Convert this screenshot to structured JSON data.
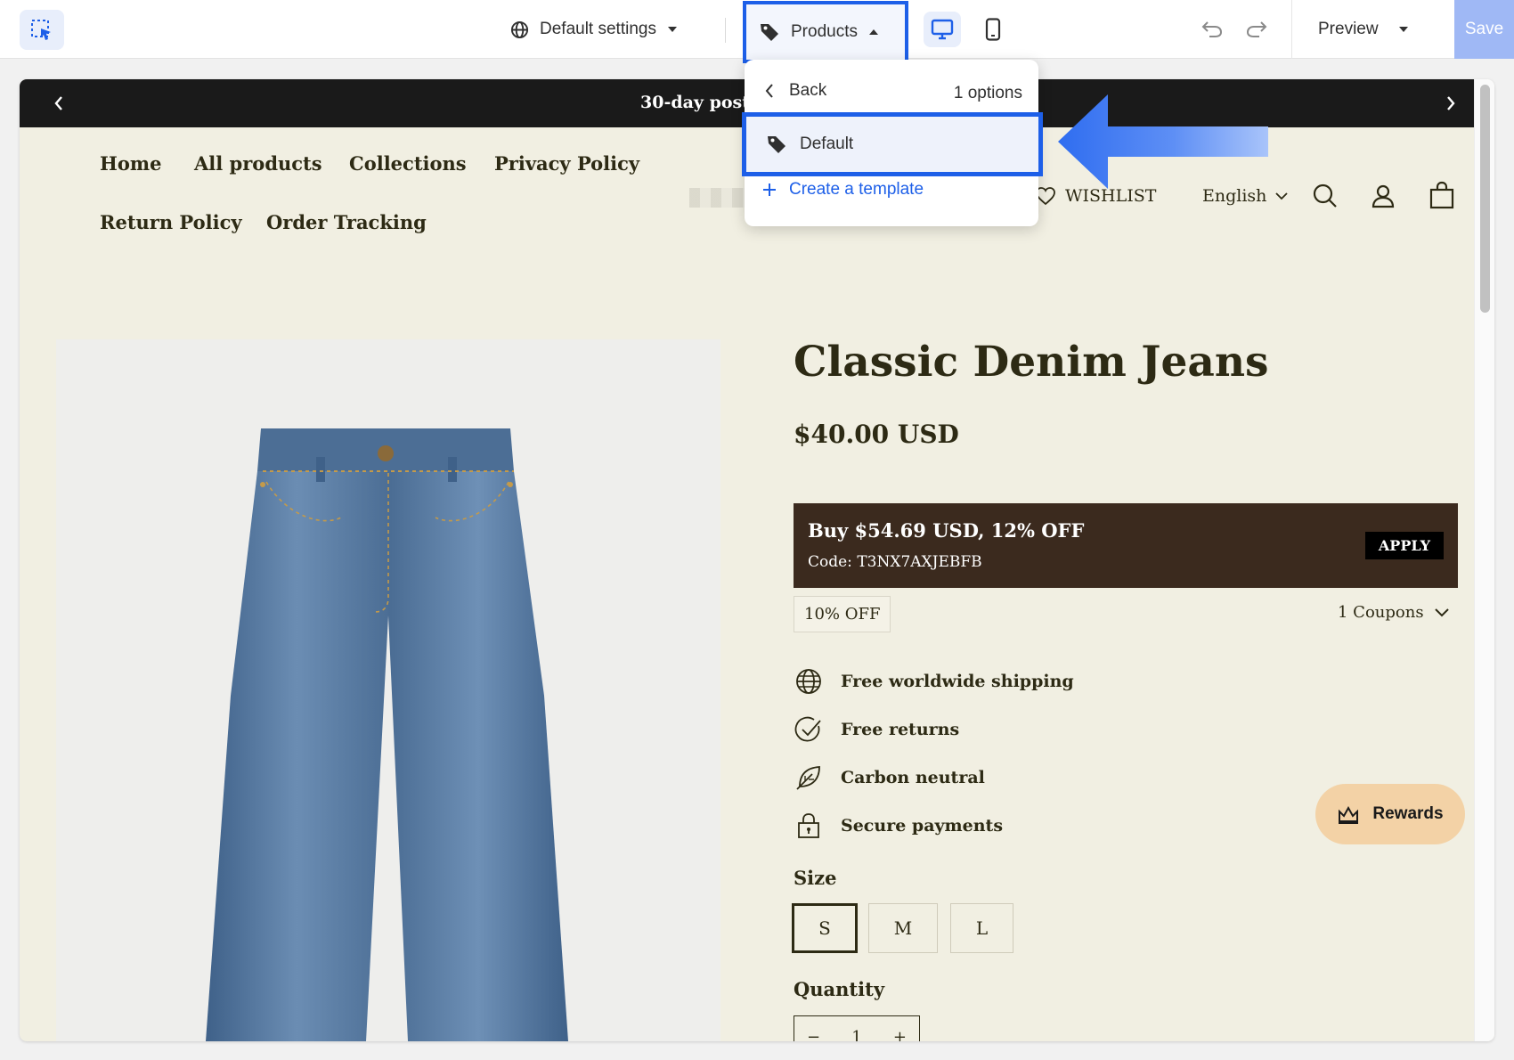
{
  "toolbar": {
    "settings_label": "Default settings",
    "template_label": "Products",
    "preview_label": "Preview",
    "save_label": "Save",
    "accent_color": "#1d5fe8"
  },
  "dropdown": {
    "back_label": "Back",
    "options_count": "1 options",
    "selected_option": "Default",
    "create_label": "Create a template"
  },
  "store": {
    "announcement": "30-day posta",
    "nav": [
      "Home",
      "All products",
      "Collections",
      "Privacy Policy",
      "Return Policy",
      "Order Tracking"
    ],
    "wishlist_label": "WISHLIST",
    "language_label": "English"
  },
  "product": {
    "title": "Classic Denim Jeans",
    "price": "$40.00 USD",
    "coupon": {
      "title": "Buy $54.69 USD, 12% OFF",
      "code": "Code: T3NX7AXJEBFB",
      "apply_label": "APPLY",
      "background": "#3b2a1e"
    },
    "discount_tag": "10% OFF",
    "coupons_count": "1 Coupons",
    "features": [
      {
        "icon": "globe-icon",
        "label": "Free worldwide shipping"
      },
      {
        "icon": "check-circle-icon",
        "label": "Free returns"
      },
      {
        "icon": "leaf-icon",
        "label": "Carbon neutral"
      },
      {
        "icon": "lock-icon",
        "label": "Secure payments"
      }
    ],
    "size_label": "Size",
    "sizes": [
      "S",
      "M",
      "L"
    ],
    "selected_size": "S",
    "quantity_label": "Quantity",
    "quantity_minus": "−",
    "quantity_value": "1",
    "quantity_plus": "+"
  },
  "rewards_label": "Rewards"
}
